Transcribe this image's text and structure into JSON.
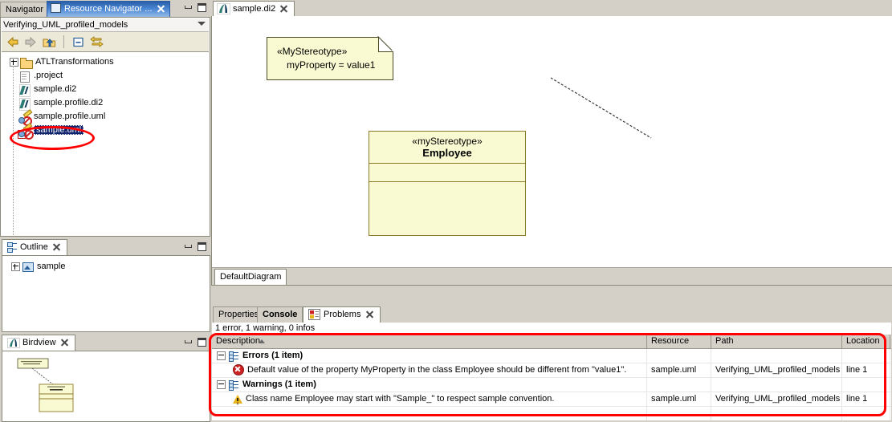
{
  "navigator": {
    "tab_navigator": "Navigator",
    "tab_resource": "Resource Navigator ...",
    "breadcrumb": "Verifying_UML_profiled_models",
    "toolbar": [
      "back-icon",
      "forward-icon",
      "up-folder-icon",
      "collapse-all-icon",
      "link-with-editor-icon"
    ],
    "tree": [
      {
        "label": "ATLTransformations",
        "icon": "folder-icon",
        "expandable": true,
        "selected": false
      },
      {
        "label": ".project",
        "icon": "file-icon",
        "expandable": false,
        "selected": false
      },
      {
        "label": "sample.di2",
        "icon": "papyrus-di2-icon",
        "expandable": false,
        "selected": false
      },
      {
        "label": "sample.profile.di2",
        "icon": "papyrus-di2-icon",
        "expandable": false,
        "selected": false
      },
      {
        "label": "sample.profile.uml",
        "icon": "uml-model-warning-icon",
        "expandable": false,
        "selected": false
      },
      {
        "label": "sample.uml",
        "icon": "uml-model-error-icon",
        "expandable": false,
        "selected": true
      }
    ]
  },
  "outline": {
    "tab": "Outline",
    "tree": [
      {
        "label": "sample",
        "icon": "outline-node-icon",
        "expandable": true
      }
    ]
  },
  "birdview": {
    "tab": "Birdview"
  },
  "editor": {
    "tab": "sample.di2",
    "tab_icon": "papyrus-di2-icon",
    "bottom_tab": "DefaultDiagram",
    "diagram": {
      "note": {
        "stereotype": "«MyStereotype»",
        "property": "myProperty = value1"
      },
      "class": {
        "stereotype": "«myStereotype»",
        "name": "Employee",
        "attributes": "",
        "operations": ""
      }
    }
  },
  "problems": {
    "tabs": [
      {
        "label": "Properties",
        "active": false
      },
      {
        "label": "Console",
        "active": false
      },
      {
        "label": "Problems",
        "active": true,
        "icon": "problems-icon"
      }
    ],
    "summary": "1 error, 1 warning, 0 infos",
    "columns": [
      "Description",
      "Resource",
      "Path",
      "Location"
    ],
    "sort_column": "Description",
    "rows": [
      {
        "type": "group",
        "icon": "group-icon",
        "description": "Errors (1 item)",
        "resource": "",
        "path": "",
        "location": ""
      },
      {
        "type": "error",
        "icon": "error-icon",
        "description": "Default value of the property MyProperty in the class Employee should be different from \"value1\".",
        "resource": "sample.uml",
        "path": "Verifying_UML_profiled_models",
        "location": "line 1"
      },
      {
        "type": "group",
        "icon": "group-icon",
        "description": "Warnings (1 item)",
        "resource": "",
        "path": "",
        "location": ""
      },
      {
        "type": "warning",
        "icon": "warning-icon",
        "description": "Class name Employee may start with \"Sample_\" to respect sample convention.",
        "resource": "sample.uml",
        "path": "Verifying_UML_profiled_models",
        "location": "line 1"
      }
    ]
  },
  "annotations": {
    "color": "#ff0000",
    "highlight_tree_item": "sample.uml",
    "highlight_region": "problems-table"
  }
}
